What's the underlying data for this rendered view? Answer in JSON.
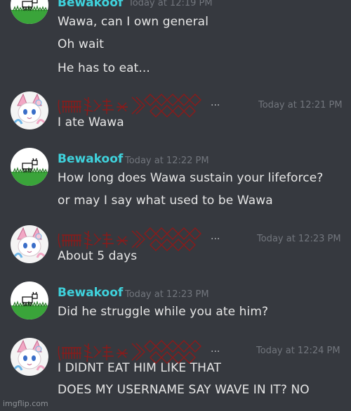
{
  "messages": [
    {
      "author": "Bewakoof",
      "avatar": "bewakoof-avatar",
      "timestamp": "Today at 12:19 PM",
      "lines": [
        "Wawa, can I own general",
        "Oh wait",
        "He has to eat..."
      ]
    },
    {
      "author": "",
      "avatar": "sylveon-avatar",
      "timestamp": "Today at 12:21 PM",
      "lines": [
        "I ate Wawa"
      ]
    },
    {
      "author": "Bewakoof",
      "avatar": "bewakoof-avatar",
      "timestamp": "Today at 12:22 PM",
      "lines": [
        "How long does Wawa sustain your lifeforce?",
        "or may I say what used to be Wawa"
      ]
    },
    {
      "author": "",
      "avatar": "sylveon-avatar",
      "timestamp": "Today at 12:23 PM",
      "lines": [
        "About 5 days"
      ]
    },
    {
      "author": "Bewakoof",
      "avatar": "bewakoof-avatar",
      "timestamp": "Today at 12:23 PM",
      "lines": [
        "Did he struggle while you ate him?"
      ]
    },
    {
      "author": "",
      "avatar": "sylveon-avatar",
      "timestamp": "Today at 12:24 PM",
      "lines": [
        "I DIDNT EAT HIM LIKE THAT",
        "DOES MY USERNAME SAY WAVE IN IT? NO"
      ]
    }
  ],
  "ellipsis": "...",
  "watermark": "imgflip.com",
  "colors": {
    "background": "#36393f",
    "bewakoof_name": "#3fd2dc",
    "timestamp": "#72767d",
    "zalgo_name": "#8b1a1a"
  }
}
